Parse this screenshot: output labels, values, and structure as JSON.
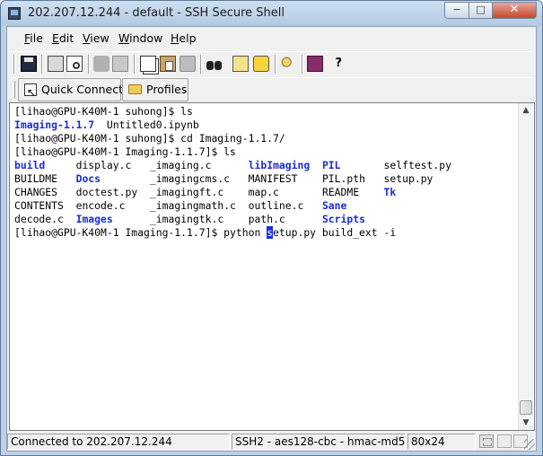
{
  "window": {
    "title": "202.207.12.244 - default - SSH Secure Shell",
    "controls": {
      "minimize": "−",
      "maximize": "□",
      "close": "✕"
    }
  },
  "menu": {
    "items": [
      {
        "label": "File",
        "mnemonic": "F",
        "rest": "ile"
      },
      {
        "label": "Edit",
        "mnemonic": "E",
        "rest": "dit"
      },
      {
        "label": "View",
        "mnemonic": "V",
        "rest": "iew"
      },
      {
        "label": "Window",
        "mnemonic": "W",
        "rest": "indow"
      },
      {
        "label": "Help",
        "mnemonic": "H",
        "rest": "elp"
      }
    ]
  },
  "toolbar": {
    "icons": [
      "save-icon",
      "print-icon",
      "print-preview-icon",
      "disconnected-icon",
      "connect-icon",
      "copy-icon",
      "paste-icon",
      "paste-disabled-icon",
      "find-icon",
      "settings-icon",
      "profile-settings-icon",
      "keys-icon",
      "help-book-icon",
      "whats-this-icon"
    ],
    "whats_this_glyph": "?"
  },
  "quickbar": {
    "quick_connect_label": "Quick Connect",
    "profiles_label": "Profiles"
  },
  "terminal": {
    "lines": [
      "[lihao@GPU-K40M-1 suhong]$ ls",
      "Imaging-1.1.7  Untitled0.ipynb",
      "[lihao@GPU-K40M-1 suhong]$ cd Imaging-1.1.7/",
      "[lihao@GPU-K40M-1 Imaging-1.1.7]$ ls",
      "build     display.c   _imaging.c      libImaging  PIL       selftest.py",
      "BUILDME   Docs        _imagingcms.c   MANIFEST    PIL.pth   setup.py",
      "CHANGES   doctest.py  _imagingft.c    map.c       README    Tk",
      "CONTENTS  encode.c    _imagingmath.c  outline.c   Sane",
      "decode.c  Images      _imagingtk.c    path.c      Scripts",
      "[lihao@GPU-K40M-1 Imaging-1.1.7]$ python setup.py build_ext -i"
    ],
    "blue_entries": [
      "Imaging-1.1.7",
      "build",
      "libImaging",
      "PIL",
      "Docs",
      "Tk",
      "Sane",
      "Images",
      "Scripts"
    ],
    "cursor_char": "s",
    "colors": {
      "directory": "#1a2ad8",
      "text": "#000000",
      "cursor_bg": "#1a2ad8"
    }
  },
  "status": {
    "connection": "Connected to 202.207.12.244",
    "encryption": "SSH2 - aes128-cbc - hmac-md5",
    "size": "80x24"
  }
}
